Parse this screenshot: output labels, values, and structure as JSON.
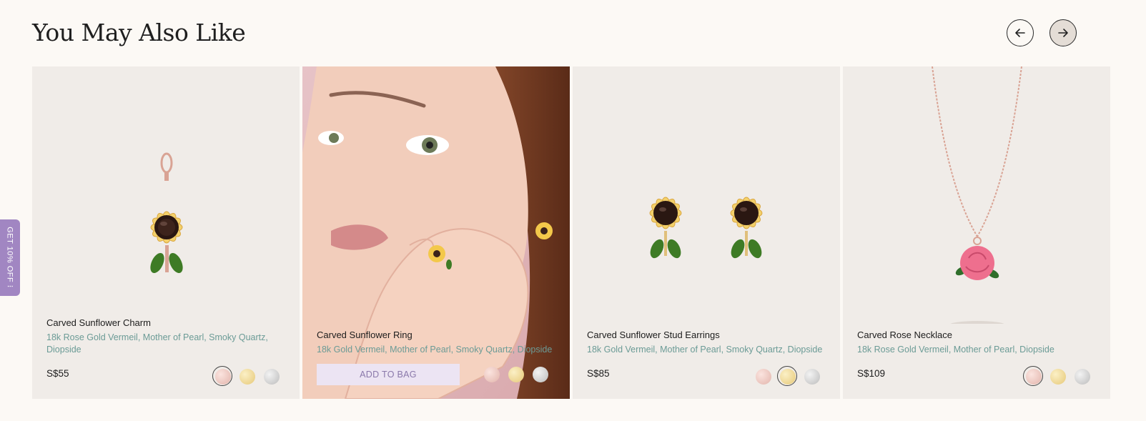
{
  "section": {
    "title": "You May Also Like"
  },
  "promo": {
    "label": "GET 10% OFF ⁝"
  },
  "products": [
    {
      "name": "Carved Sunflower Charm",
      "materials": "18k Rose Gold Vermeil, Mother of Pearl, Smoky Quartz, Diopside",
      "price": "S$55",
      "swatches": [
        "rose-gold",
        "gold",
        "silver"
      ],
      "selected_swatch": "rose-gold"
    },
    {
      "name": "Carved Sunflower Ring",
      "materials": "18k Gold Vermeil, Mother of Pearl, Smoky Quartz, Diopside",
      "button": "ADD TO BAG",
      "swatches": [
        "rose-gold",
        "gold",
        "silver"
      ],
      "selected_swatch": ""
    },
    {
      "name": "Carved Sunflower Stud Earrings",
      "materials": "18k Gold Vermeil, Mother of Pearl, Smoky Quartz, Diopside",
      "price": "S$85",
      "swatches": [
        "rose-gold",
        "gold",
        "silver"
      ],
      "selected_swatch": "gold"
    },
    {
      "name": "Carved Rose Necklace",
      "materials": "18k Rose Gold Vermeil, Mother of Pearl, Diopside",
      "price": "S$109",
      "swatches": [
        "rose-gold",
        "gold",
        "silver"
      ],
      "selected_swatch": "rose-gold"
    }
  ],
  "colors": {
    "background": "#fcf9f5",
    "card": "#f0ece8",
    "materials_text": "#6b9b96",
    "promo": "#a186c2",
    "add_to_bag": "#ece4f3"
  },
  "icons": {
    "prev": "arrow-left-icon",
    "next": "arrow-right-icon"
  }
}
